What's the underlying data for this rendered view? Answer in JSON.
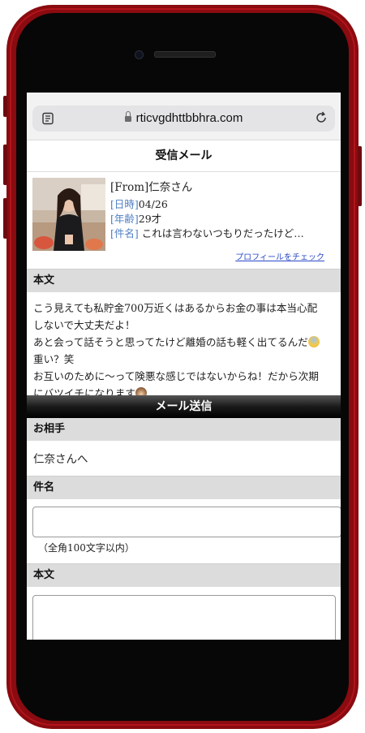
{
  "browser": {
    "url": "rticvgdhttbbhra.com"
  },
  "page": {
    "title": "受信メール"
  },
  "profile": {
    "name": "[From]仁奈さん",
    "date_label": "[日時]",
    "date_value": "04/26",
    "age_label": "[年齢]",
    "age_value": "29才",
    "subject_label": "[件名]",
    "subject_value": "これは言わないつもりだったけど…",
    "profile_link": "プロフィールをチェック"
  },
  "message": {
    "section_label": "本文",
    "lines": [
      "こう見えても私貯金700万近くはあるからお金の事は本当心配",
      "しないで大丈夫だよ！",
      "あと会って話そうと思ってたけど離婚の話も軽く出てるんだ",
      "重い？笑",
      "お互いのために〜って険悪な感じではないからね！だから次期",
      "にバツイチになります"
    ]
  },
  "compose": {
    "send_title": "メール送信",
    "to_label": "お相手",
    "to_value": "仁奈さんへ",
    "subject_label": "件名",
    "subject_value": "",
    "subject_hint": "（全角100文字以内）",
    "body_label": "本文",
    "body_value": ""
  },
  "colors": {
    "phone_frame": "#8a0b10",
    "label_blue": "#4e7ec2",
    "link_blue": "#2b49c9",
    "section_gray": "#dcdcdc"
  },
  "icons": {
    "menu": "reader-menu-icon",
    "lock": "lock-icon",
    "reload": "reload-icon",
    "emoji_scared": "fearful-face-emoji",
    "emoji_monkey": "see-no-evil-monkey-emoji"
  }
}
